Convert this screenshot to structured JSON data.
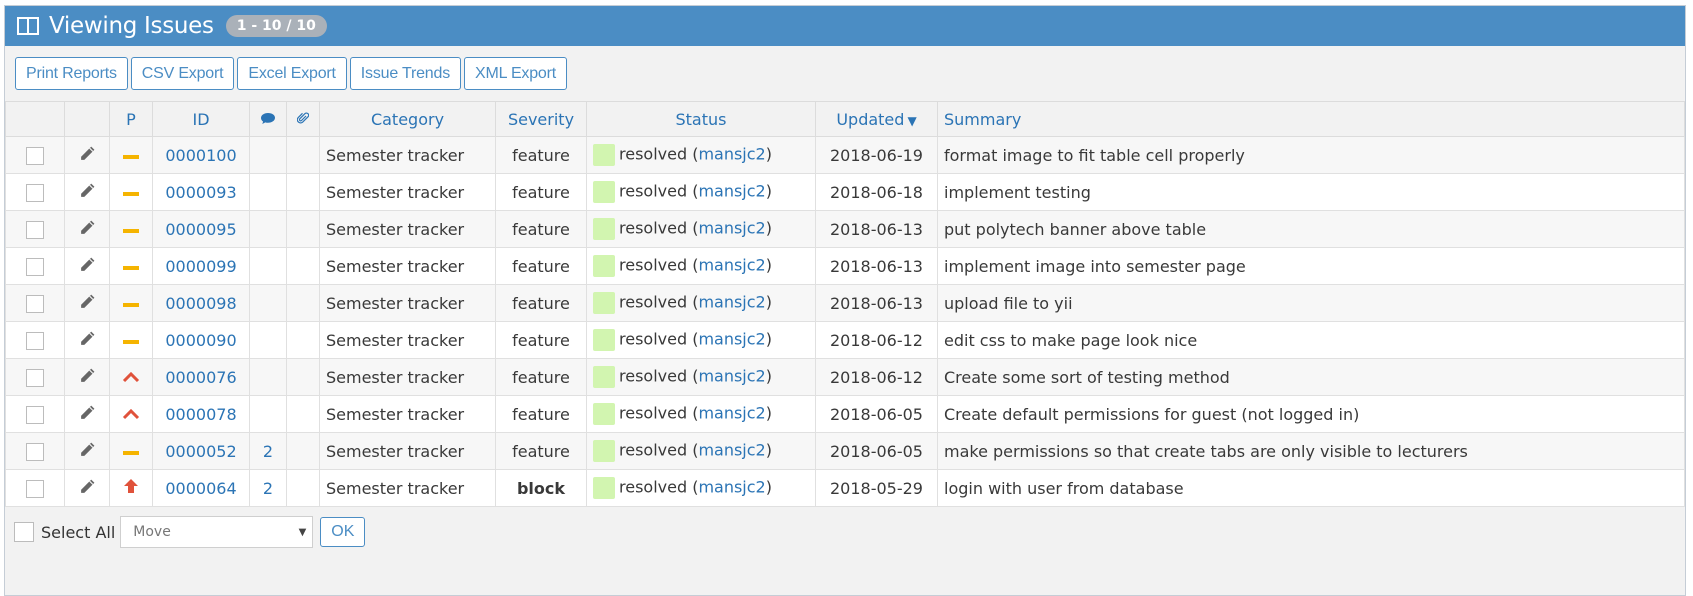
{
  "header": {
    "title": "Viewing Issues",
    "badge": "1 - 10 / 10"
  },
  "toolbar": {
    "buttons": [
      "Print Reports",
      "CSV Export",
      "Excel Export",
      "Issue Trends",
      "XML Export"
    ]
  },
  "table": {
    "columns": {
      "priority": "P",
      "id": "ID",
      "category": "Category",
      "severity": "Severity",
      "status": "Status",
      "updated": "Updated",
      "summary": "Summary"
    },
    "rows": [
      {
        "priority": "normal",
        "id": "0000100",
        "notes": "",
        "category": "Semester tracker",
        "severity": "feature",
        "status": "resolved",
        "handler": "mansjc2",
        "updated": "2018-06-19",
        "summary": "format image to fit table cell properly"
      },
      {
        "priority": "normal",
        "id": "0000093",
        "notes": "",
        "category": "Semester tracker",
        "severity": "feature",
        "status": "resolved",
        "handler": "mansjc2",
        "updated": "2018-06-18",
        "summary": "implement testing"
      },
      {
        "priority": "normal",
        "id": "0000095",
        "notes": "",
        "category": "Semester tracker",
        "severity": "feature",
        "status": "resolved",
        "handler": "mansjc2",
        "updated": "2018-06-13",
        "summary": "put polytech banner above table"
      },
      {
        "priority": "normal",
        "id": "0000099",
        "notes": "",
        "category": "Semester tracker",
        "severity": "feature",
        "status": "resolved",
        "handler": "mansjc2",
        "updated": "2018-06-13",
        "summary": "implement image into semester page"
      },
      {
        "priority": "normal",
        "id": "0000098",
        "notes": "",
        "category": "Semester tracker",
        "severity": "feature",
        "status": "resolved",
        "handler": "mansjc2",
        "updated": "2018-06-13",
        "summary": "upload file to yii"
      },
      {
        "priority": "normal",
        "id": "0000090",
        "notes": "",
        "category": "Semester tracker",
        "severity": "feature",
        "status": "resolved",
        "handler": "mansjc2",
        "updated": "2018-06-12",
        "summary": "edit css to make page look nice"
      },
      {
        "priority": "high",
        "id": "0000076",
        "notes": "",
        "category": "Semester tracker",
        "severity": "feature",
        "status": "resolved",
        "handler": "mansjc2",
        "updated": "2018-06-12",
        "summary": "Create some sort of testing method"
      },
      {
        "priority": "high",
        "id": "0000078",
        "notes": "",
        "category": "Semester tracker",
        "severity": "feature",
        "status": "resolved",
        "handler": "mansjc2",
        "updated": "2018-06-05",
        "summary": "Create default permissions for guest (not logged in)"
      },
      {
        "priority": "normal",
        "id": "0000052",
        "notes": "2",
        "category": "Semester tracker",
        "severity": "feature",
        "status": "resolved",
        "handler": "mansjc2",
        "updated": "2018-06-05",
        "summary": "make permissions so that create tabs are only visible to lecturers"
      },
      {
        "priority": "urgent",
        "id": "0000064",
        "notes": "2",
        "category": "Semester tracker",
        "severity": "block",
        "status": "resolved",
        "handler": "mansjc2",
        "updated": "2018-05-29",
        "summary": "login with user from database"
      }
    ]
  },
  "footer": {
    "select_all": "Select All",
    "move_select": "Move",
    "ok": "OK"
  },
  "colors": {
    "header_bg": "#4b8dc4",
    "link": "#2b74b5",
    "resolved": "#d2f5b0",
    "priority_normal": "#f5b400",
    "priority_high": "#e0523b"
  }
}
